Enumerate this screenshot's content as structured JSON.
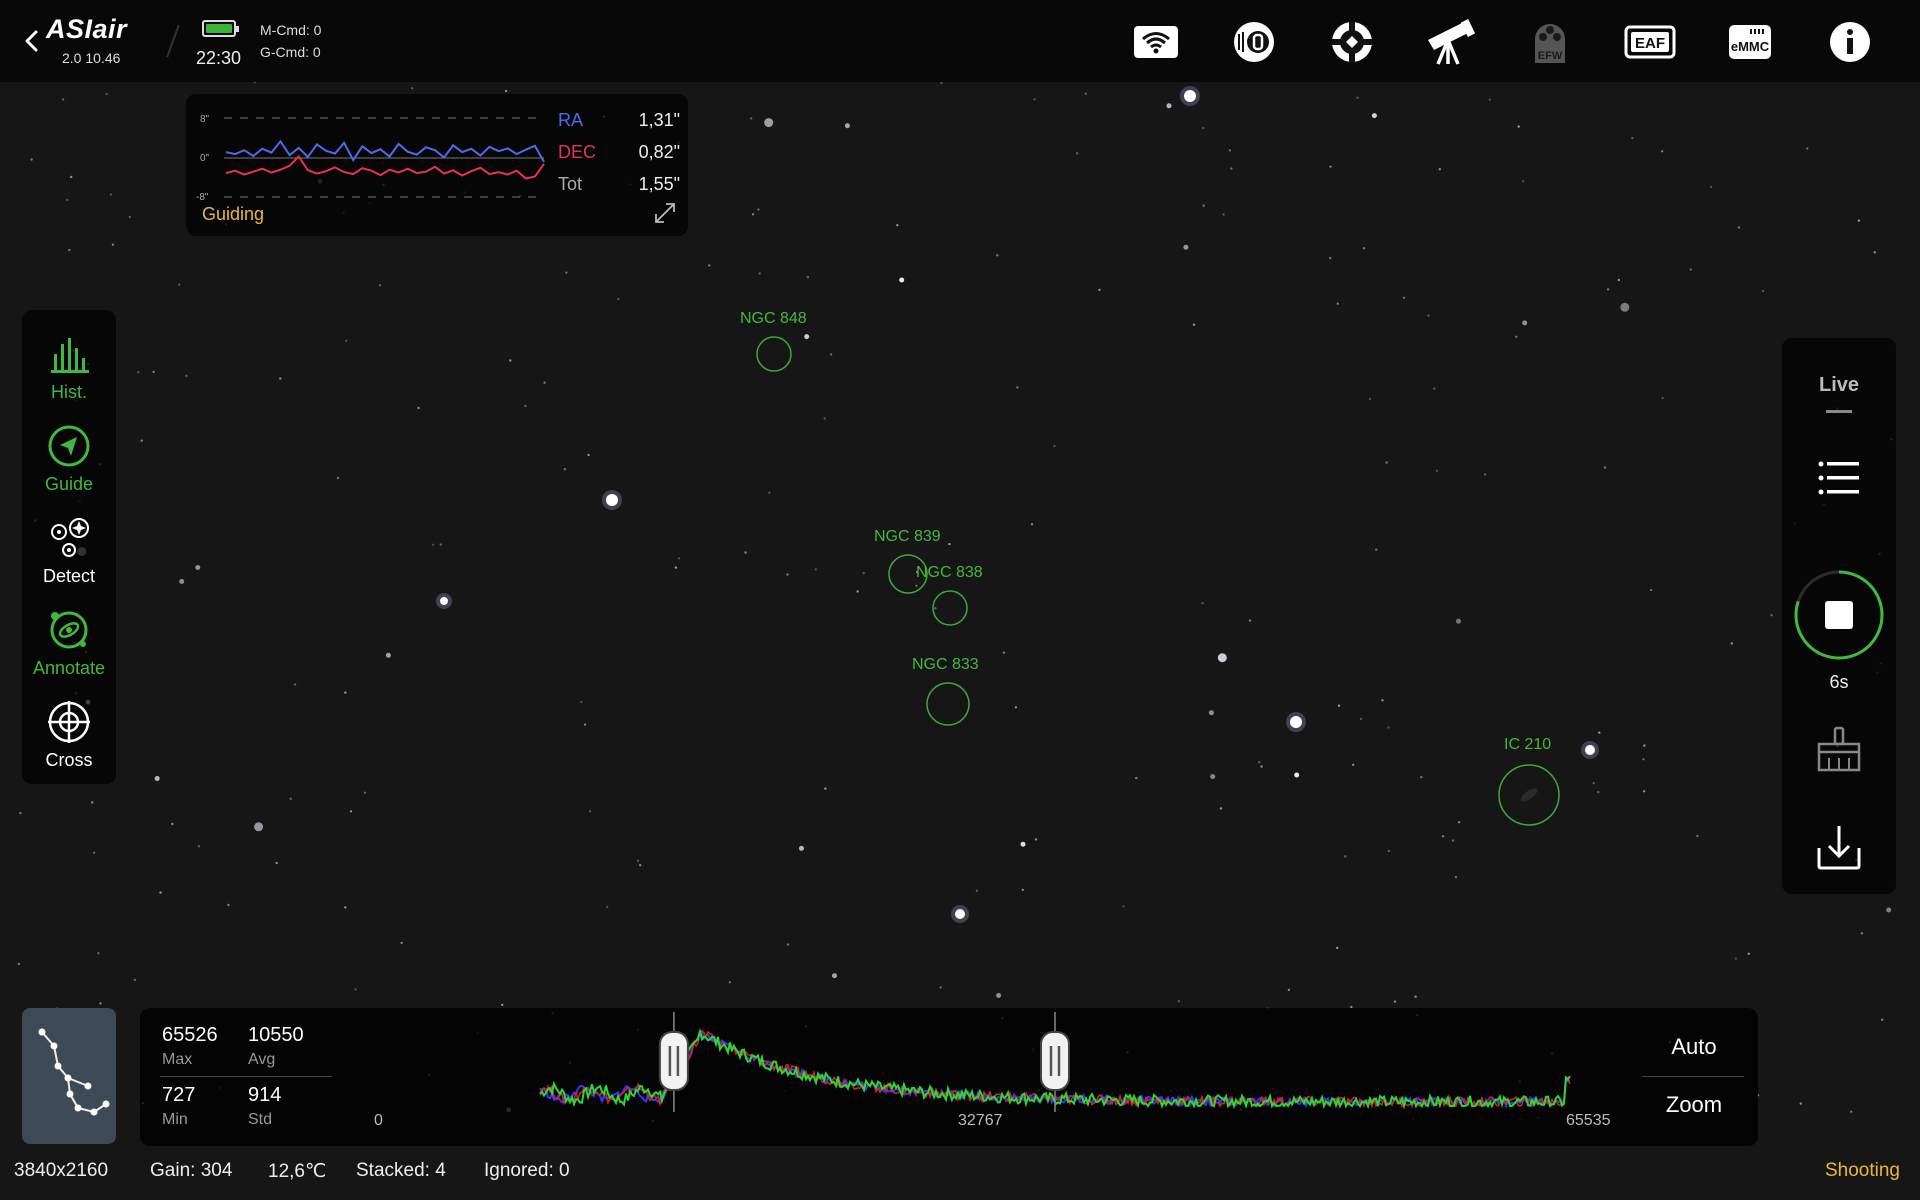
{
  "header": {
    "app_logo": "ASIair",
    "version": "2.0 10.46",
    "clock": "22:30",
    "mount_cmd": "M-Cmd: 0",
    "guide_cmd": "G-Cmd: 0",
    "icons": [
      "wifi-icon",
      "storage-icon",
      "guide-target-icon",
      "telescope-icon",
      "efw-icon",
      "eaf-icon",
      "emmc-icon",
      "info-icon"
    ],
    "efw_label": "EFW",
    "eaf_label": "EAF",
    "emmc_label": "eMMC"
  },
  "guiding": {
    "title": "Guiding",
    "axis_labels": [
      "8\"",
      "0\"",
      "-8\""
    ],
    "rows": [
      {
        "key": "RA",
        "value": "1,31\"",
        "color": "#4a6cf0"
      },
      {
        "key": "DEC",
        "value": "0,82\"",
        "color": "#e8305a"
      },
      {
        "key": "Tot",
        "value": "1,55\"",
        "color": "#aaaaaa"
      }
    ],
    "ra_series": [
      1.2,
      0.8,
      1.6,
      0.4,
      1.9,
      1.1,
      3.4,
      0.6,
      2.1,
      0.2,
      2.8,
      1.5,
      0.9,
      3.1,
      -0.4,
      2.4,
      1.0,
      1.8,
      0.3,
      2.9,
      1.3,
      0.7,
      2.2,
      1.6,
      0.1,
      2.6,
      1.2,
      1.9,
      0.5,
      2.3,
      1.4,
      2.0,
      0.8,
      1.7,
      2.5,
      -0.8
    ],
    "dec_series": [
      -3.1,
      -2.6,
      -3.4,
      -2.8,
      -2.2,
      -3.0,
      -2.4,
      -1.6,
      0.3,
      -2.5,
      -3.2,
      -2.7,
      -1.9,
      -2.9,
      -3.3,
      -2.1,
      -2.6,
      -3.5,
      -2.4,
      -3.0,
      -2.2,
      -3.1,
      -2.8,
      -1.8,
      -3.2,
      -2.5,
      -3.6,
      -2.7,
      -2.0,
      -3.3,
      -2.9,
      -3.4,
      -2.6,
      -4.2,
      -3.8,
      -1.2
    ]
  },
  "left_tools": [
    {
      "label": "Hist.",
      "icon": "histogram-icon",
      "active": true
    },
    {
      "label": "Guide",
      "icon": "guide-icon",
      "active": true
    },
    {
      "label": "Detect",
      "icon": "detect-stars-icon",
      "active": false
    },
    {
      "label": "Annotate",
      "icon": "annotate-galaxy-icon",
      "active": true
    },
    {
      "label": "Cross",
      "icon": "crosshair-icon",
      "active": false
    }
  ],
  "annotations": [
    {
      "label": "NGC 848"
    },
    {
      "label": "NGC 839"
    },
    {
      "label": "NGC 838"
    },
    {
      "label": "NGC 833"
    },
    {
      "label": "IC 210"
    }
  ],
  "right_panel": {
    "mode": "Live",
    "exposure": "6s",
    "exposure_progress": 0.8,
    "icons": [
      "list-icon",
      "stop-icon",
      "clear-brush-icon",
      "download-icon"
    ]
  },
  "histogram": {
    "max": "65526",
    "max_label": "Max",
    "avg": "10550",
    "avg_label": "Avg",
    "min": "727",
    "min_label": "Min",
    "std": "914",
    "std_label": "Std",
    "ticks": [
      "0",
      "32767",
      "65535"
    ],
    "black_point": 0.13,
    "mid_point": 0.5,
    "auto_label": "Auto",
    "zoom_label": "Zoom"
  },
  "status": {
    "resolution": "3840x2160",
    "gain": "Gain: 304",
    "temperature": "12,6℃",
    "stacked": "Stacked: 4",
    "ignored": "Ignored: 0",
    "state": "Shooting"
  },
  "colors": {
    "accent_green": "#42b83f",
    "guiding_yellow": "#e8b83a",
    "ra_blue": "#4a6cf0",
    "dec_red": "#e8305a"
  }
}
